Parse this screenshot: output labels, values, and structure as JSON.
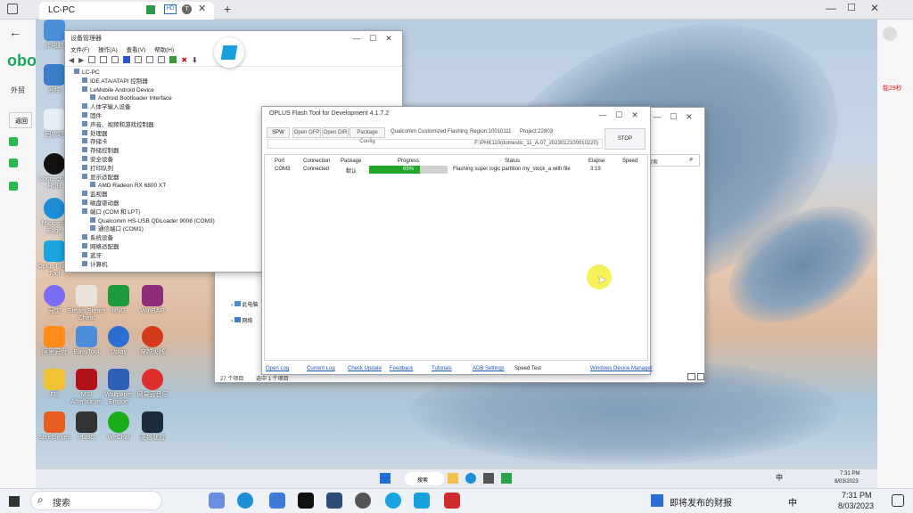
{
  "outer": {
    "tab_title": "LC-PC",
    "left_texts": [
      "obo",
      "外贸",
      "返回"
    ],
    "right_texts": [
      "能29秒"
    ]
  },
  "desktop_icons": [
    {
      "label": "此电脑",
      "color": "#4a90d9"
    },
    {
      "label": "网络",
      "color": "#3c7fc8"
    },
    {
      "label": "回收站",
      "color": "#e6eef6"
    },
    {
      "label": "控制面板",
      "color": "#2f76c5"
    },
    {
      "label": "Logitech G HUB",
      "color": "#111"
    },
    {
      "label": "Microsoft Edge",
      "color": "#1c8fd6"
    },
    {
      "label": "Oplus Flash Tool",
      "color": "#1aa4e0"
    },
    {
      "label": "元宝",
      "color": "#7b6cf6"
    },
    {
      "label": "Steam Steam Cheat",
      "color": "#e8e2d8"
    },
    {
      "label": "RNG",
      "color": "#1e9a3a"
    },
    {
      "label": "WinRAR",
      "color": "#8e2d7a"
    },
    {
      "label": "阿里云盘",
      "color": "#ff8c1a"
    },
    {
      "label": "EasyTool",
      "color": "#4c8fd8"
    },
    {
      "label": "Uplay",
      "color": "#2a6fd1"
    },
    {
      "label": "穿越火线",
      "color": "#d43a1c"
    },
    {
      "label": "FE",
      "color": "#f1c232"
    },
    {
      "label": "MSI Afterburner",
      "color": "#b4121b"
    },
    {
      "label": "Wallpaper Engine",
      "color": "#2b5fb8"
    },
    {
      "label": "网易云音乐",
      "color": "#e02d2d"
    },
    {
      "label": "SteelSeries",
      "color": "#e85d1f"
    },
    {
      "label": "PUBG",
      "color": "#333"
    },
    {
      "label": "WeChat",
      "color": "#1aad19"
    },
    {
      "label": "英雄联盟",
      "color": "#1b2c3a"
    }
  ],
  "device_manager": {
    "title": "设备管理器",
    "menu": [
      "文件(F)",
      "操作(A)",
      "查看(V)",
      "帮助(H)"
    ],
    "tree": [
      {
        "text": "LC-PC",
        "indent": 0
      },
      {
        "text": "IDE ATA/ATAPI 控制器",
        "indent": 1
      },
      {
        "text": "LeMobile Android Device",
        "indent": 1
      },
      {
        "text": "Android Bootloader Interface",
        "indent": 2
      },
      {
        "text": "人体学输入设备",
        "indent": 1
      },
      {
        "text": "固件",
        "indent": 1
      },
      {
        "text": "声音、视频和游戏控制器",
        "indent": 1
      },
      {
        "text": "处理器",
        "indent": 1
      },
      {
        "text": "存储卡",
        "indent": 1
      },
      {
        "text": "存储控制器",
        "indent": 1
      },
      {
        "text": "安全设备",
        "indent": 1
      },
      {
        "text": "打印队列",
        "indent": 1
      },
      {
        "text": "显示适配器",
        "indent": 1
      },
      {
        "text": "AMD Radeon RX 6800 XT",
        "indent": 2
      },
      {
        "text": "监视器",
        "indent": 1
      },
      {
        "text": "磁盘驱动器",
        "indent": 1
      },
      {
        "text": "端口 (COM 和 LPT)",
        "indent": 1
      },
      {
        "text": "Qualcomm HS-USB QDLoader 9008 (COM3)",
        "indent": 2
      },
      {
        "text": "通信端口 (COM1)",
        "indent": 2
      },
      {
        "text": "系统设备",
        "indent": 1
      },
      {
        "text": "网络适配器",
        "indent": 1
      },
      {
        "text": "蓝牙",
        "indent": 1
      },
      {
        "text": "计算机",
        "indent": 1
      }
    ]
  },
  "explorer": {
    "nav_items": [
      "此电脑",
      "网络"
    ],
    "status": "27 个项目",
    "selected": "选中 1 个项目",
    "search_placeholder": "中搜索"
  },
  "flash_tool": {
    "title": "OPLUS Flash Tool for Development 4.1.7.2",
    "buttons": [
      "SPW",
      "Open OFP",
      "Open DIR",
      "Package Config"
    ],
    "info": {
      "mode": "Qualcomm Customized Flashing",
      "region": "Region:10010111",
      "project": "Project:22803"
    },
    "path": "F:\\PHK110(domestic_11_A.07_2023012100010220)",
    "stop_label": "STOP",
    "columns": [
      "Port",
      "Connection",
      "Package",
      "Progress",
      "Status",
      "Elapse",
      "Speed"
    ],
    "row": {
      "port": "COM3",
      "connection": "Connected",
      "package": "默认",
      "progress_label": "65%",
      "progress": 0.65,
      "status": "Flashing super logic partition my_stock_a with file",
      "elapse": "3:19",
      "speed": ""
    },
    "footer_links": [
      "Open Log",
      "Current Log",
      "Check Update",
      "Feedback",
      "Tutorials",
      "ADB Settings",
      "Speed Test",
      "Windows Device Manager"
    ]
  },
  "inner_taskbar": {
    "search": "搜索",
    "time": "7:31 PM",
    "date": "8/03/2023",
    "ime": "中"
  },
  "taskbar": {
    "search": "搜索",
    "news": "即将发布的财报",
    "ime": "中",
    "time": "7:31 PM",
    "date": "8/03/2023"
  }
}
